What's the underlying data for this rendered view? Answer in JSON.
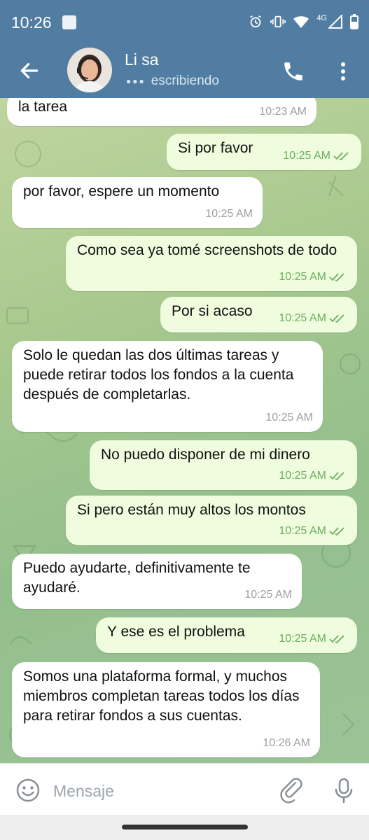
{
  "status_bar": {
    "time": "10:26",
    "network": "4G"
  },
  "header": {
    "contact_name": "Li sa",
    "status": "escribiendo"
  },
  "messages": [
    {
      "dir": "in",
      "text": "la tarea",
      "time": "10:23 AM"
    },
    {
      "dir": "out",
      "text": "Si por favor",
      "time": "10:25 AM"
    },
    {
      "dir": "in",
      "text": "por favor, espere un momento",
      "time": "10:25 AM"
    },
    {
      "dir": "out",
      "text": "Como sea ya tomé screenshots de todo",
      "time": "10:25 AM"
    },
    {
      "dir": "out",
      "text": "Por si acaso",
      "time": "10:25 AM"
    },
    {
      "dir": "in",
      "text": "Solo le quedan las dos últimas tareas y puede retirar todos los fondos a la cuenta después de completarlas.",
      "time": "10:25 AM"
    },
    {
      "dir": "out",
      "text": "No puedo disponer de mi dinero",
      "time": "10:25 AM"
    },
    {
      "dir": "out",
      "text": "Si pero están muy altos los montos",
      "time": "10:25 AM"
    },
    {
      "dir": "in",
      "text": "Puedo ayudarte, definitivamente te ayudaré.",
      "time": "10:25 AM"
    },
    {
      "dir": "out",
      "text": "Y ese es el problema",
      "time": "10:25 AM"
    },
    {
      "dir": "in",
      "text": "Somos una plataforma formal, y muchos miembros completan tareas todos los días para retirar fondos a sus cuentas.",
      "time": "10:26 AM"
    }
  ],
  "input": {
    "placeholder": "Mensaje"
  },
  "colors": {
    "header": "#517da2",
    "incoming": "#ffffff",
    "outgoing": "#effdde",
    "tick": "#6cae5f"
  },
  "icons": [
    "back-arrow-icon",
    "phone-icon",
    "more-vert-icon",
    "emoji-icon",
    "paperclip-icon",
    "microphone-icon",
    "double-check-icon"
  ]
}
